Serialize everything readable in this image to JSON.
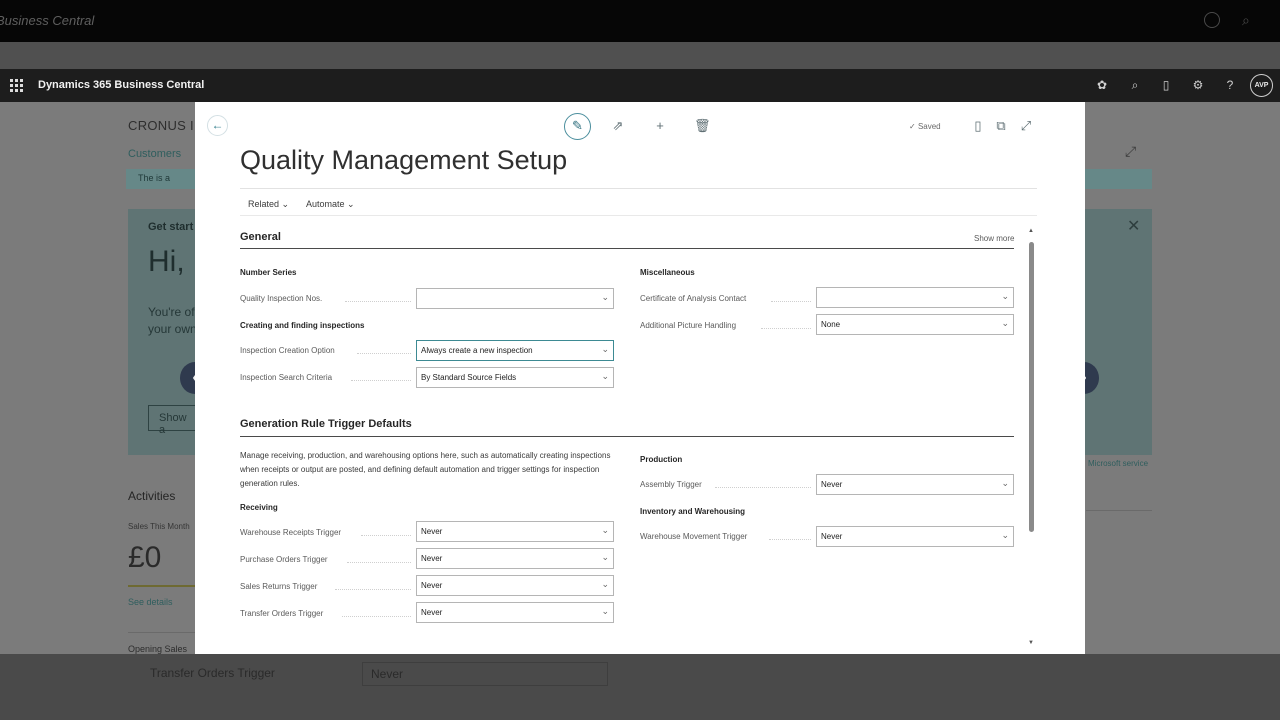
{
  "outer": {
    "title": "Business Central",
    "bottom_field_label": "Transfer Orders Trigger",
    "bottom_field_value": "Never"
  },
  "appbar": {
    "title": "Dynamics 365 Business Central",
    "avatar": "AVP"
  },
  "background": {
    "company": "CRONUS IN",
    "breadcrumb": "Customers",
    "notification": "The is a",
    "get_started": "Get start",
    "greeting": "Hi,",
    "line1": "You're of",
    "line2": "your own",
    "show_button": "Show a",
    "ms_link": "Microsoft service",
    "activities": "Activities",
    "sales_label": "Sales This Month",
    "sales_value": "£0",
    "see_details": "See details",
    "open_sales": "Opening Sales"
  },
  "page": {
    "title": "Quality Management Setup",
    "saved": "Saved",
    "actions": [
      "Related",
      "Automate"
    ]
  },
  "general": {
    "title": "General",
    "show_more": "Show more",
    "number_series": "Number Series",
    "quality_inspection_nos_label": "Quality Inspection Nos.",
    "quality_inspection_nos_value": "",
    "creating_finding": "Creating and finding inspections",
    "creation_option_label": "Inspection Creation Option",
    "creation_option_value": "Always create a new inspection",
    "search_criteria_label": "Inspection Search Criteria",
    "search_criteria_value": "By Standard Source Fields",
    "miscellaneous": "Miscellaneous",
    "coa_contact_label": "Certificate of Analysis Contact",
    "coa_contact_value": "",
    "picture_handling_label": "Additional Picture Handling",
    "picture_handling_value": "None"
  },
  "generation": {
    "title": "Generation Rule Trigger Defaults",
    "description": "Manage receiving, production, and warehousing options here, such as automatically creating inspections when receipts or output are posted, and defining default automation and trigger settings for inspection generation rules.",
    "receiving": "Receiving",
    "warehouse_receipts_label": "Warehouse Receipts Trigger",
    "warehouse_receipts_value": "Never",
    "purchase_orders_label": "Purchase Orders Trigger",
    "purchase_orders_value": "Never",
    "sales_returns_label": "Sales Returns Trigger",
    "sales_returns_value": "Never",
    "transfer_orders_label": "Transfer Orders Trigger",
    "transfer_orders_value": "Never",
    "production": "Production",
    "assembly_label": "Assembly Trigger",
    "assembly_value": "Never",
    "inventory_warehousing": "Inventory and Warehousing",
    "warehouse_movement_label": "Warehouse Movement Trigger",
    "warehouse_movement_value": "Never"
  }
}
